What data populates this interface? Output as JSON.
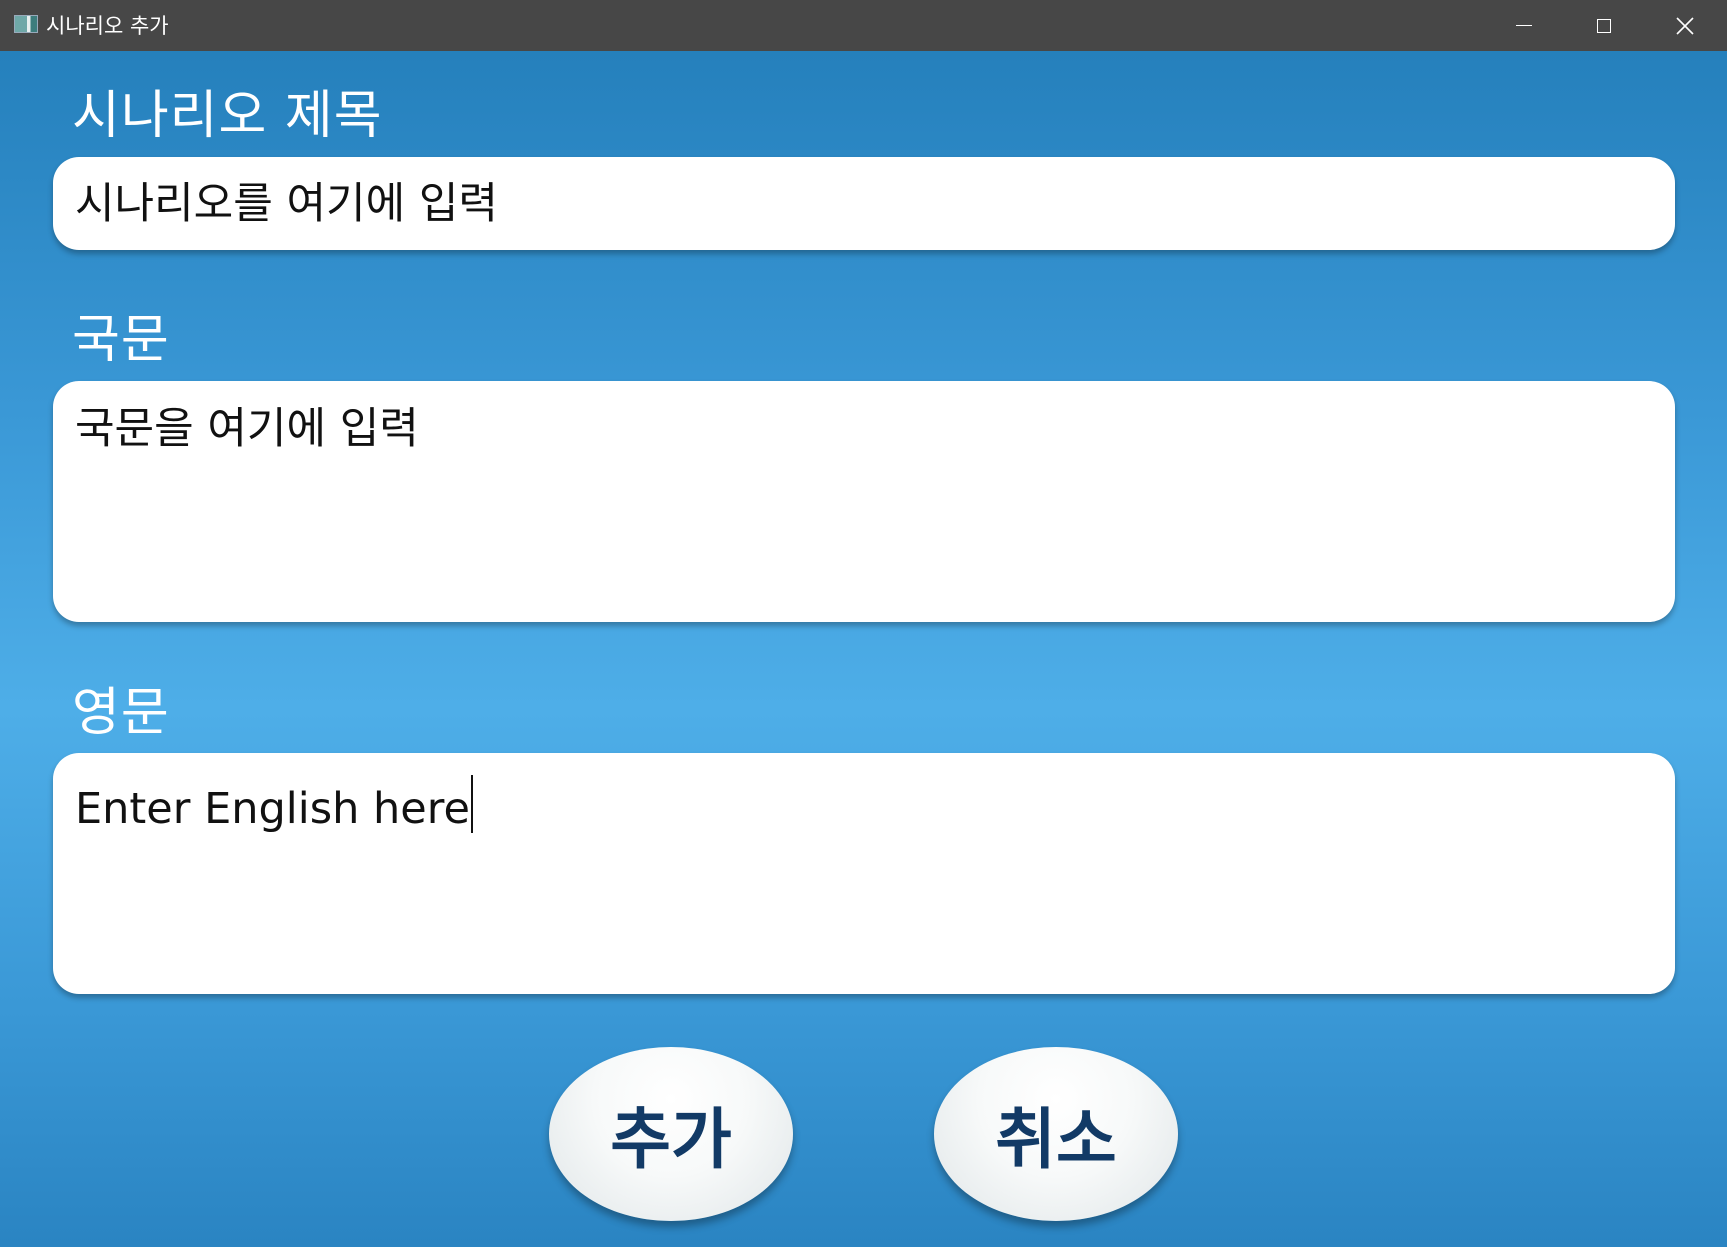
{
  "window": {
    "title": "시나리오 추가",
    "controls": [
      "minimize",
      "maximize",
      "close"
    ]
  },
  "form": {
    "title_label": "시나리오 제목",
    "title_placeholder": "시나리오를 여기에 입력",
    "korean_label": "국문",
    "korean_placeholder": "국문을 여기에 입력",
    "english_label": "영문",
    "english_value": "Enter English here"
  },
  "buttons": {
    "add_label": "추가",
    "cancel_label": "취소"
  },
  "colors": {
    "titlebar": "#474747",
    "background_top": "#2580bc",
    "background_mid": "#4eaee8",
    "button_text": "#123a66"
  }
}
